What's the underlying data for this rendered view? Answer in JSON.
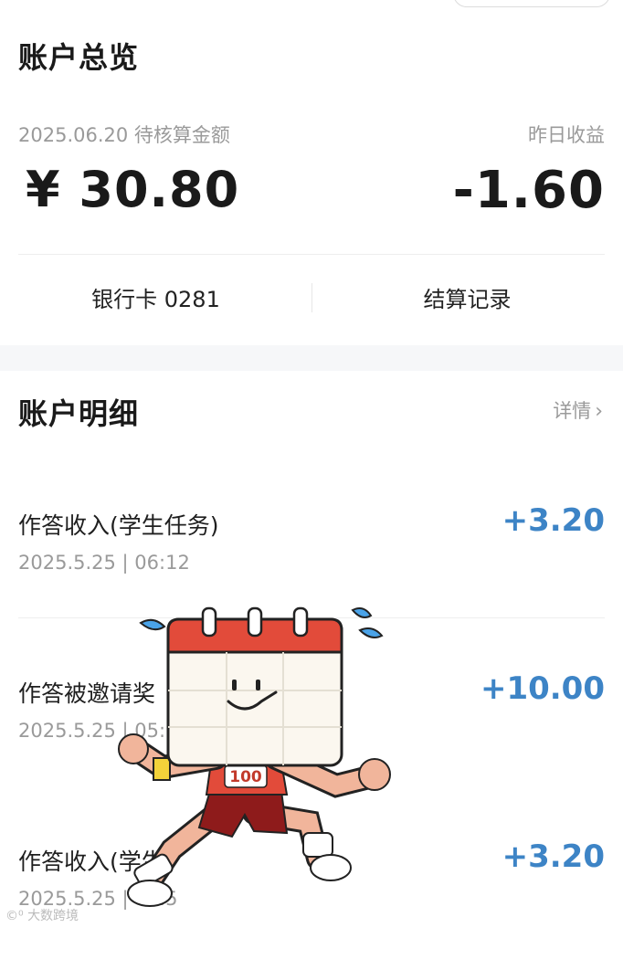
{
  "overview": {
    "title": "账户总览",
    "pending_label": "2025.06.20 待核算金额",
    "pending_amount": "¥ 30.80",
    "yesterday_label": "昨日收益",
    "yesterday_amount": "-1.60",
    "bank_card": "银行卡 0281",
    "settlement_records": "结算记录"
  },
  "details": {
    "title": "账户明细",
    "more_label": "详情",
    "more_chevron": "›",
    "amount_color": "#3d84c6",
    "transactions": [
      {
        "title": "作答收入(学生任务)",
        "time": "2025.5.25 | 06:12",
        "amount": "+3.20"
      },
      {
        "title": "作答被邀请奖",
        "time": "2025.5.25 | 05:3",
        "amount": "+10.00"
      },
      {
        "title": "作答收入(学生",
        "time": "2025.5.25 | 05:5",
        "amount": "+3.20"
      }
    ]
  },
  "sticker": {
    "icon": "running-calendar-sticker",
    "badge": "100"
  },
  "watermark": "©⁰ 大数跨境"
}
